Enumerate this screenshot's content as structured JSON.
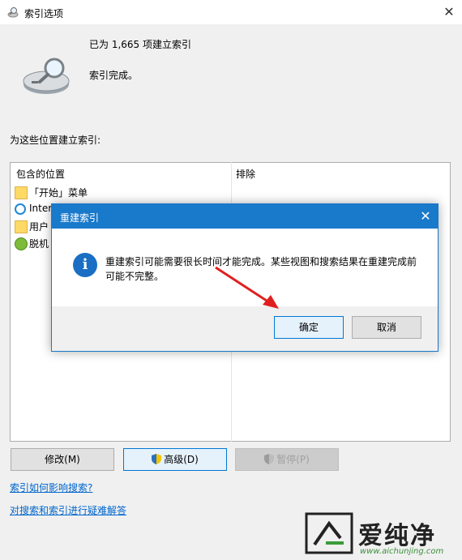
{
  "window": {
    "title": "索引选项",
    "close_glyph": "✕"
  },
  "status": {
    "count_text": "已为 1,665 项建立索引",
    "state_text": "索引完成。"
  },
  "locations_label": "为这些位置建立索引:",
  "table": {
    "col_included": "包含的位置",
    "col_excluded": "排除",
    "rows": [
      {
        "label": "「开始」菜单",
        "icon": "folder-icon"
      },
      {
        "label": "Inter",
        "icon": "internet-explorer-icon"
      },
      {
        "label": "用户",
        "icon": "folder-icon"
      },
      {
        "label": "脱机",
        "icon": "offline-files-icon"
      }
    ]
  },
  "buttons": {
    "modify": "修改(M)",
    "advanced": "高级(D)",
    "pause": "暂停(P)"
  },
  "links": {
    "how_affects": "索引如何影响搜索?",
    "troubleshoot": "对搜索和索引进行疑难解答"
  },
  "dialog": {
    "title": "重建索引",
    "close_glyph": "✕",
    "info_glyph": "i",
    "message": "重建索引可能需要很长时间才能完成。某些视图和搜索结果在重建完成前可能不完整。",
    "ok_label": "确定",
    "cancel_label": "取消",
    "accent_color": "#1979ca"
  },
  "watermark": {
    "text": "爱纯净",
    "url": "www.aichunjing.com"
  }
}
